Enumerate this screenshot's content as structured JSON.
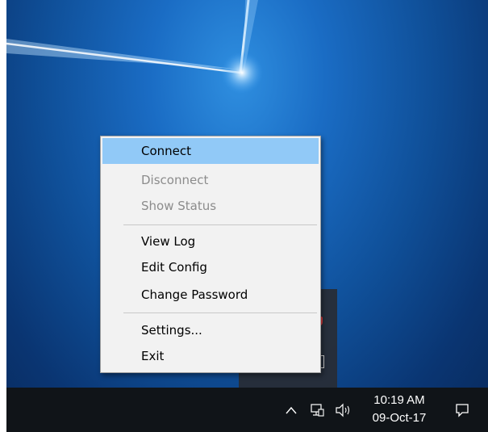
{
  "menu": {
    "items": [
      {
        "label": "Connect",
        "state": "highlighted"
      },
      {
        "label": "Disconnect",
        "state": "disabled"
      },
      {
        "label": "Show Status",
        "state": "disabled"
      },
      {
        "label": "View Log",
        "state": "enabled"
      },
      {
        "label": "Edit Config",
        "state": "enabled"
      },
      {
        "label": "Change Password",
        "state": "enabled"
      },
      {
        "label": "Settings...",
        "state": "enabled"
      },
      {
        "label": "Exit",
        "state": "enabled"
      }
    ]
  },
  "taskbar": {
    "clock": {
      "time": "10:19 AM",
      "date": "09-Oct-17"
    },
    "icons": [
      "chevron-up-icon",
      "network-icon",
      "volume-icon",
      "action-center-icon"
    ]
  },
  "colors": {
    "menu_highlight": "#91c9f7",
    "menu_disabled_text": "#8c8c8c",
    "taskbar": "#101418",
    "desktop": "#0f4f98"
  }
}
